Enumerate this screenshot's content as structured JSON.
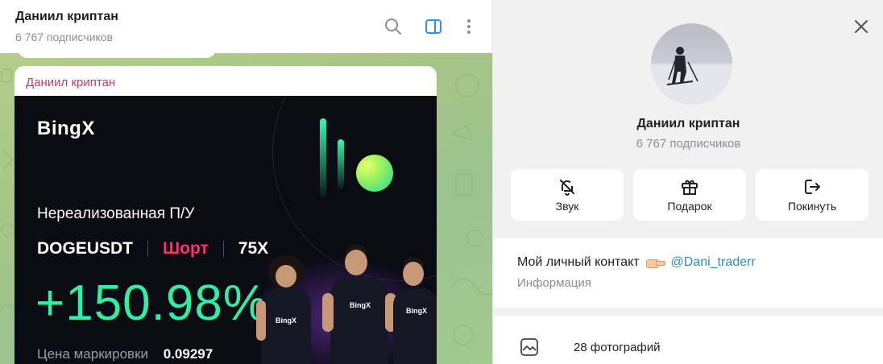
{
  "chat": {
    "title": "Даниил криптан",
    "subtitle": "6 767 подписчиков",
    "header_icons": [
      "search-icon",
      "sidebar-toggle-icon",
      "more-vertical-icon"
    ],
    "accent": "#3390ec"
  },
  "message": {
    "author": "Даниил криптан",
    "author_color": "#c03d68",
    "promo": {
      "logo": "BingX",
      "heading": "Нереализованная П/У",
      "pair": "DOGEUSDT",
      "side": "Шорт",
      "leverage": "75X",
      "pnl": "+150.98%",
      "mark_label": "Цена маркировки",
      "mark_value": "0.09297",
      "jersey_text": "BingX",
      "side_color": "#ff2f72",
      "pnl_color": "#2ef0a5"
    }
  },
  "profile": {
    "name": "Даниил криптан",
    "subscribers": "6 767 подписчиков",
    "actions": [
      {
        "label": "Звук",
        "icon": "bell-off-icon"
      },
      {
        "label": "Подарок",
        "icon": "gift-icon"
      },
      {
        "label": "Покинуть",
        "icon": "leave-icon"
      }
    ],
    "info": {
      "text": "Мой личный контакт",
      "emoji": "pointing-hand-emoji",
      "link": "@Dani_traderr",
      "caption": "Информация"
    },
    "media": {
      "label": "28 фотографий",
      "icon": "photo-icon"
    }
  }
}
